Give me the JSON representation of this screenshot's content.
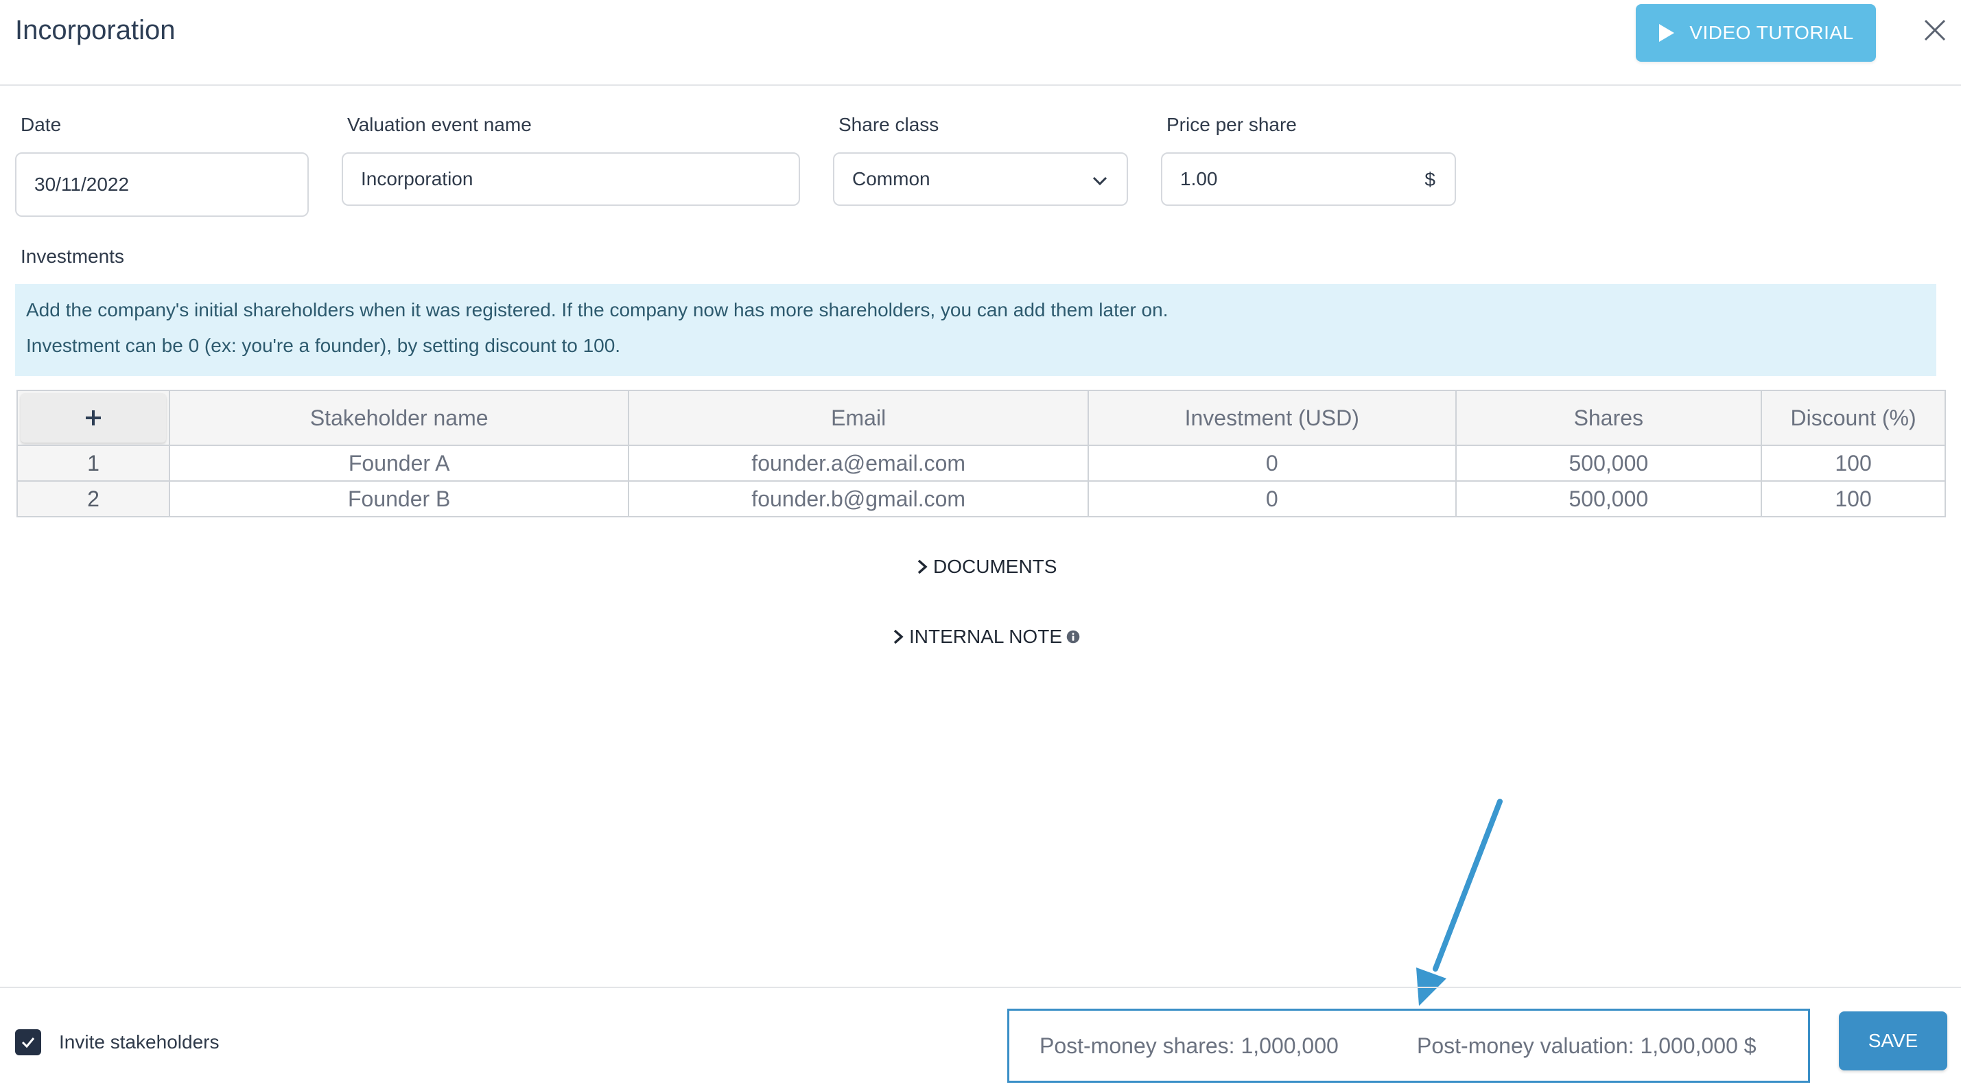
{
  "header": {
    "title": "Incorporation",
    "video_label": "VIDEO TUTORIAL"
  },
  "form": {
    "date": {
      "label": "Date",
      "value": "30/11/2022"
    },
    "event_name": {
      "label": "Valuation event name",
      "value": "Incorporation"
    },
    "share_class": {
      "label": "Share class",
      "value": "Common"
    },
    "price": {
      "label": "Price per share",
      "value": "1.00",
      "suffix": "$"
    }
  },
  "investments": {
    "label": "Investments",
    "info_line1": "Add the company's initial shareholders when it was registered. If the company now has more shareholders, you can add them later on.",
    "info_line2": "Investment can be 0 (ex: you're a founder), by setting discount to 100.",
    "columns": [
      "Stakeholder name",
      "Email",
      "Investment (USD)",
      "Shares",
      "Discount (%)"
    ],
    "rows": [
      {
        "index": "1",
        "name": "Founder A",
        "email": "founder.a@email.com",
        "investment": "0",
        "shares": "500,000",
        "discount": "100"
      },
      {
        "index": "2",
        "name": "Founder B",
        "email": "founder.b@gmail.com",
        "investment": "0",
        "shares": "500,000",
        "discount": "100"
      }
    ]
  },
  "sections": {
    "documents": "DOCUMENTS",
    "internal_note": "INTERNAL NOTE"
  },
  "footer": {
    "invite_label": "Invite stakeholders",
    "post_money_shares": "Post-money shares: 1,000,000",
    "post_money_valuation": "Post-money valuation: 1,000,000 $",
    "save_label": "SAVE"
  },
  "colors": {
    "accent": "#3a8fc7",
    "video_button": "#5ebde6",
    "info_bg": "#dff2fa",
    "checkbox": "#243044"
  }
}
